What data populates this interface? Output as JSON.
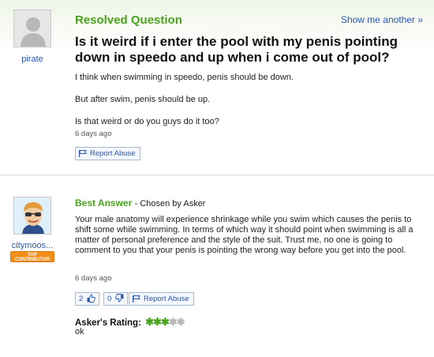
{
  "question": {
    "status": "Resolved Question",
    "show_more": "Show me another »",
    "asker": "pirate",
    "title": "Is it weird if i enter the pool with my penis pointing down in speedo and up when i come out of pool?",
    "body": [
      "I think when swimming in speedo, penis should be down.",
      "But after swim, penis should be up.",
      "Is that weird or do you guys do it too?"
    ],
    "time": "6 days ago",
    "report_label": "Report Abuse"
  },
  "answer": {
    "heading": "Best Answer",
    "chosen_by": "- Chosen by Asker",
    "answerer": "citymoos...",
    "badge_line1": "TOP",
    "badge_line2": "CONTRIBUTOR",
    "body": "Your male anatomy will experience shrinkage while you swim which causes the penis to shift some while swimming. In terms of which way it should point when swimming is all a matter of personal preference and the style of the suit. Trust me, no one is going to comment to you that your penis is pointing the wrong way before you get into the pool.",
    "time": "6 days ago",
    "thumbs_up_count": "2",
    "thumbs_down_count": "0",
    "report_label": "Report Abuse",
    "rating_label": "Asker's Rating:",
    "rating_value": 3,
    "rating_max": 5,
    "rating_comment": "ok"
  },
  "colors": {
    "green": "#4aa31e",
    "link_blue": "#2a55b4",
    "badge_orange": "#f28f1b"
  },
  "icons": {
    "report": "flag-icon",
    "up": "thumbs-up-icon",
    "down": "thumbs-down-icon"
  }
}
